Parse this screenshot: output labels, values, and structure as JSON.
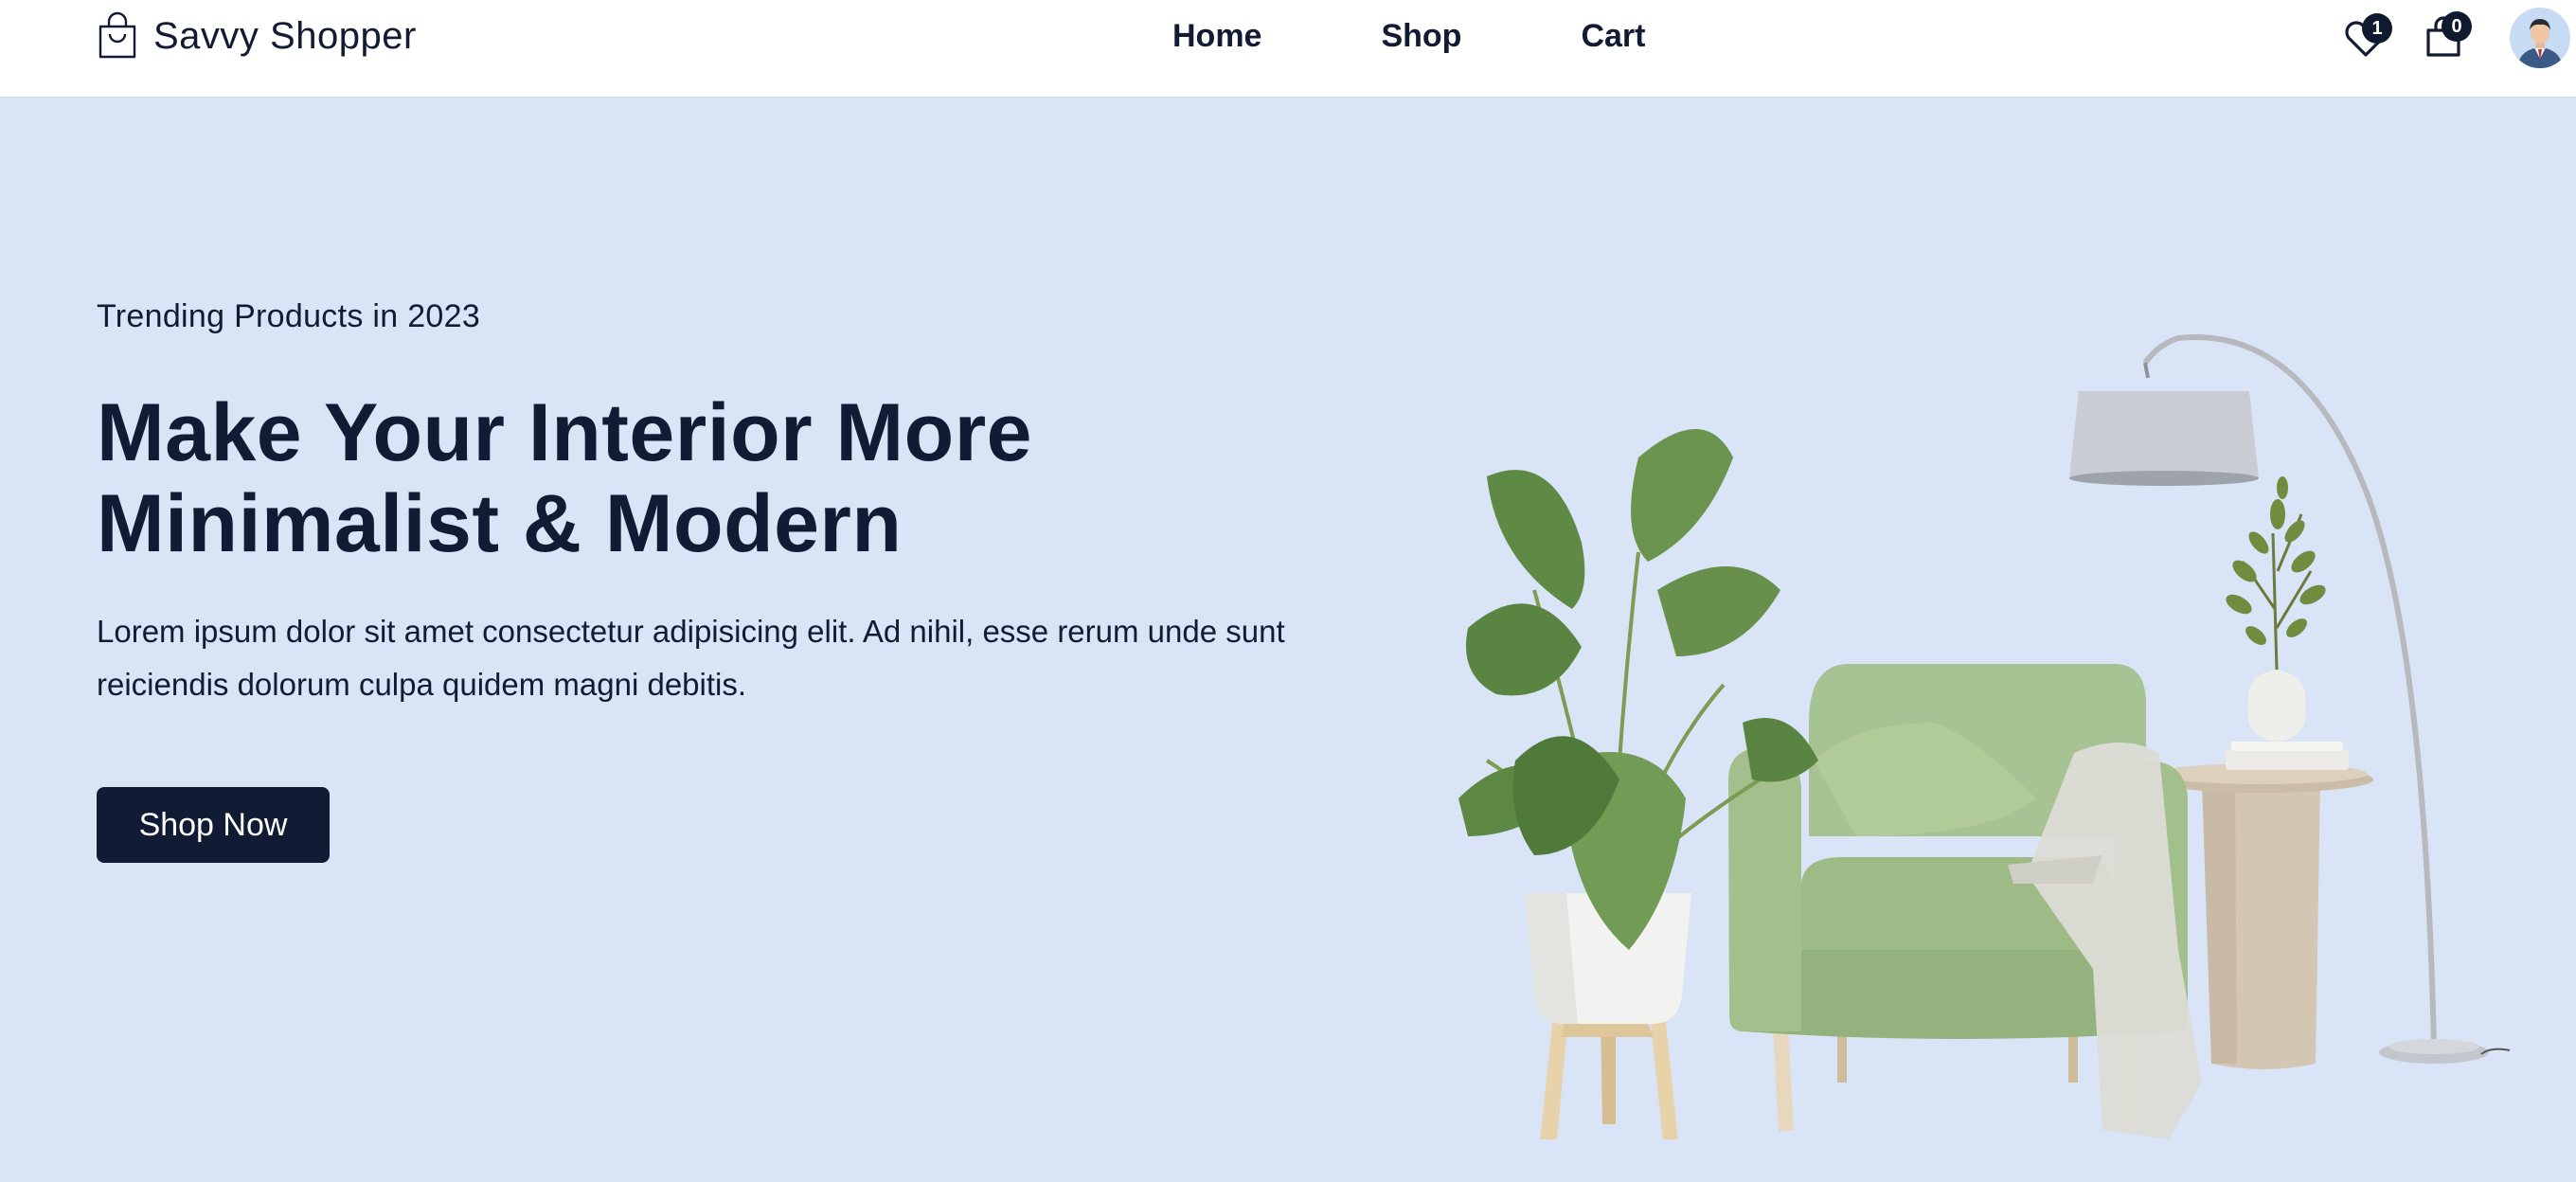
{
  "brand": {
    "name": "Savvy Shopper",
    "icon": "shopping-bag-icon"
  },
  "nav": {
    "links": [
      {
        "label": "Home"
      },
      {
        "label": "Shop"
      },
      {
        "label": "Cart"
      }
    ]
  },
  "header_icons": {
    "wishlist": {
      "icon": "heart-icon",
      "count": "1"
    },
    "cart": {
      "icon": "bag-icon",
      "count": "0"
    },
    "profile": {
      "icon": "user-avatar"
    }
  },
  "hero": {
    "eyebrow": "Trending Products in 2023",
    "headline_line1": "Make Your Interior More",
    "headline_line2": "Minimalist & Modern",
    "description": "Lorem ipsum dolor sit amet consectetur adipisicing elit. Ad nihil, esse rerum unde sunt reiciendis dolorum culpa quidem magni debitis.",
    "cta_label": "Shop Now"
  },
  "colors": {
    "primary": "#111b33",
    "hero_background": "#d9e4f7",
    "navbar_background": "#ffffff",
    "armchair": "#9dbb86"
  }
}
